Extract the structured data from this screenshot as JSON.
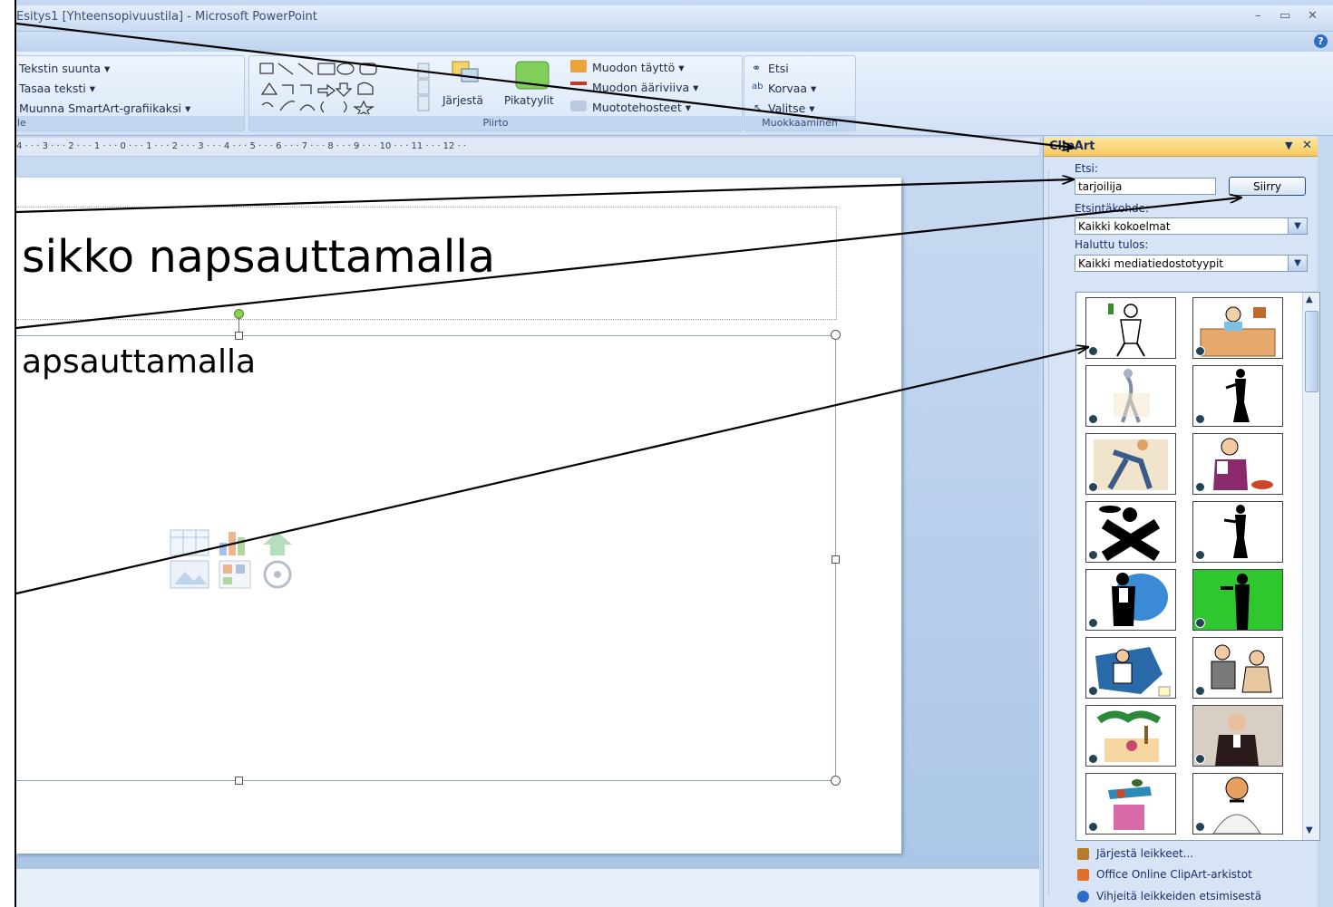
{
  "window": {
    "title": "Esitys1 [Yhteensopivuustila] - Microsoft PowerPoint",
    "min_glyph": "–",
    "max_glyph": "▭",
    "close_glyph": "✕",
    "help_glyph": "?"
  },
  "ribbon": {
    "paragraph_group": {
      "text_direction": "Tekstin suunta ▾",
      "align_text": "Tasaa teksti ▾",
      "convert_smartart": "Muunna SmartArt-grafiikaksi ▾",
      "label": "le"
    },
    "drawing_group": {
      "arrange": "Järjestä",
      "quick_styles": "Pikatyylit",
      "shape_fill": "Muodon täyttö ▾",
      "shape_outline": "Muodon ääriviiva ▾",
      "shape_effects": "Muototehosteet ▾",
      "label": "Piirto"
    },
    "editing_group": {
      "find": "Etsi",
      "replace": "Korvaa ▾",
      "select": "Valitse ▾",
      "label": "Muokkaaminen"
    }
  },
  "ruler": "4 · · · 3 · · · 2 · · · 1 · · · 0 · · · 1 · · · 2 · · · 3 · · · 4 · · · 5 · · · 6 · · · 7 · · · 8 · · · 9 · · · 10 · · · 11 · · · 12 · ·",
  "slide": {
    "title_placeholder": "sikko napsauttamalla",
    "content_placeholder": "apsauttamalla"
  },
  "clipart_pane": {
    "title": "ClipArt",
    "search_label": "Etsi:",
    "search_value": "tarjoilija",
    "go_button": "Siirry",
    "search_in_label": "Etsintäkohde:",
    "search_in_value": "Kaikki kokoelmat",
    "results_type_label": "Haluttu tulos:",
    "results_type_value": "Kaikki mediatiedostotyypit",
    "links": [
      "Järjestä leikkeet...",
      "Office Online ClipArt-arkistot",
      "Vihjeitä leikkeiden etsimisestä"
    ]
  },
  "colors": {
    "pane_header": "#f8c860",
    "ribbon_bg": "#d2e2f6",
    "arrow": "#000000"
  }
}
